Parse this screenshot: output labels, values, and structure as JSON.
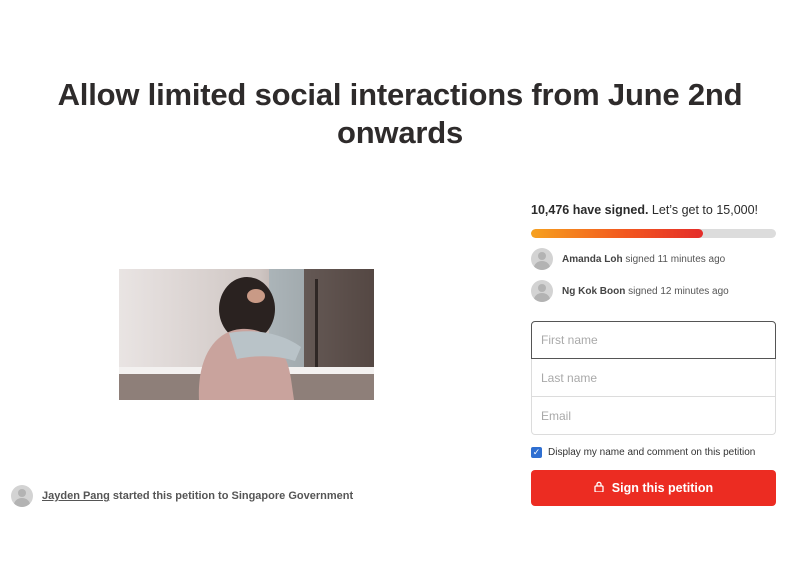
{
  "petition": {
    "title_line1": "Allow limited social interactions from June 2nd",
    "title_line2": "onwards"
  },
  "starter": {
    "name": "Jayden Pang",
    "text": "started this petition to Singapore Government"
  },
  "signatures": {
    "count_text": "10,476 have signed.",
    "goal_text": "Let’s get to 15,000!",
    "progress_fraction": 0.7,
    "recent": [
      {
        "name": "Amanda Loh",
        "when": "signed 11 minutes ago"
      },
      {
        "name": "Ng Kok Boon",
        "when": "signed 12 minutes ago"
      }
    ]
  },
  "form": {
    "first_name_placeholder": "First name",
    "last_name_placeholder": "Last name",
    "email_placeholder": "Email",
    "consent_label": "Display my name and comment on this petition",
    "consent_checked": true,
    "submit_label": "Sign this petition",
    "submit_icon": "lock-icon"
  },
  "colors": {
    "primary_button": "#ec2c22",
    "progress_start": "#f6a11f",
    "progress_end": "#e42d2a",
    "checkbox": "#2f6fd1"
  }
}
